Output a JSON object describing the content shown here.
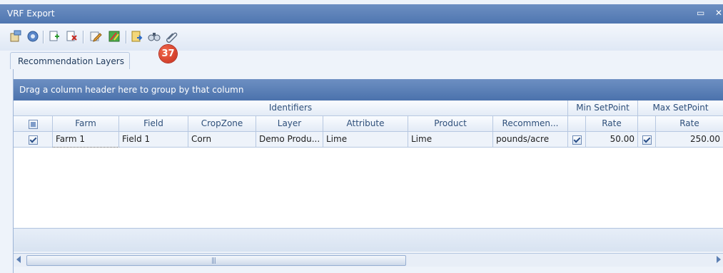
{
  "window": {
    "title": "VRF Export"
  },
  "toolbar": {
    "icons": [
      "properties-icon",
      "help-icon",
      "add-layer-icon",
      "remove-layer-icon",
      "edit-icon",
      "map-edit-icon",
      "export-icon",
      "find-icon",
      "attach-icon"
    ],
    "badge_count": "37"
  },
  "tabs": [
    {
      "label": "Recommendation Layers"
    }
  ],
  "grid": {
    "group_hint": "Drag a column header here to group by that column",
    "bands": [
      "Identifiers",
      "Min SetPoint",
      "Max SetPoint"
    ],
    "columns": [
      "Farm",
      "Field",
      "CropZone",
      "Layer",
      "Attribute",
      "Product",
      "Recommen...",
      "Rate",
      "Rate"
    ],
    "rows": [
      {
        "selected": true,
        "farm": "Farm 1",
        "field": "Field 1",
        "cropzone": "Corn",
        "layer": "Demo Produ...",
        "attribute": "Lime",
        "product": "Lime",
        "recommendation": "pounds/acre",
        "min_enabled": true,
        "min_rate": "50.00",
        "max_enabled": true,
        "max_rate": "250.00"
      }
    ]
  },
  "colors": {
    "accent": "#5a7fb8",
    "header_band": "#4f76b0",
    "badge": "#d8402a"
  }
}
